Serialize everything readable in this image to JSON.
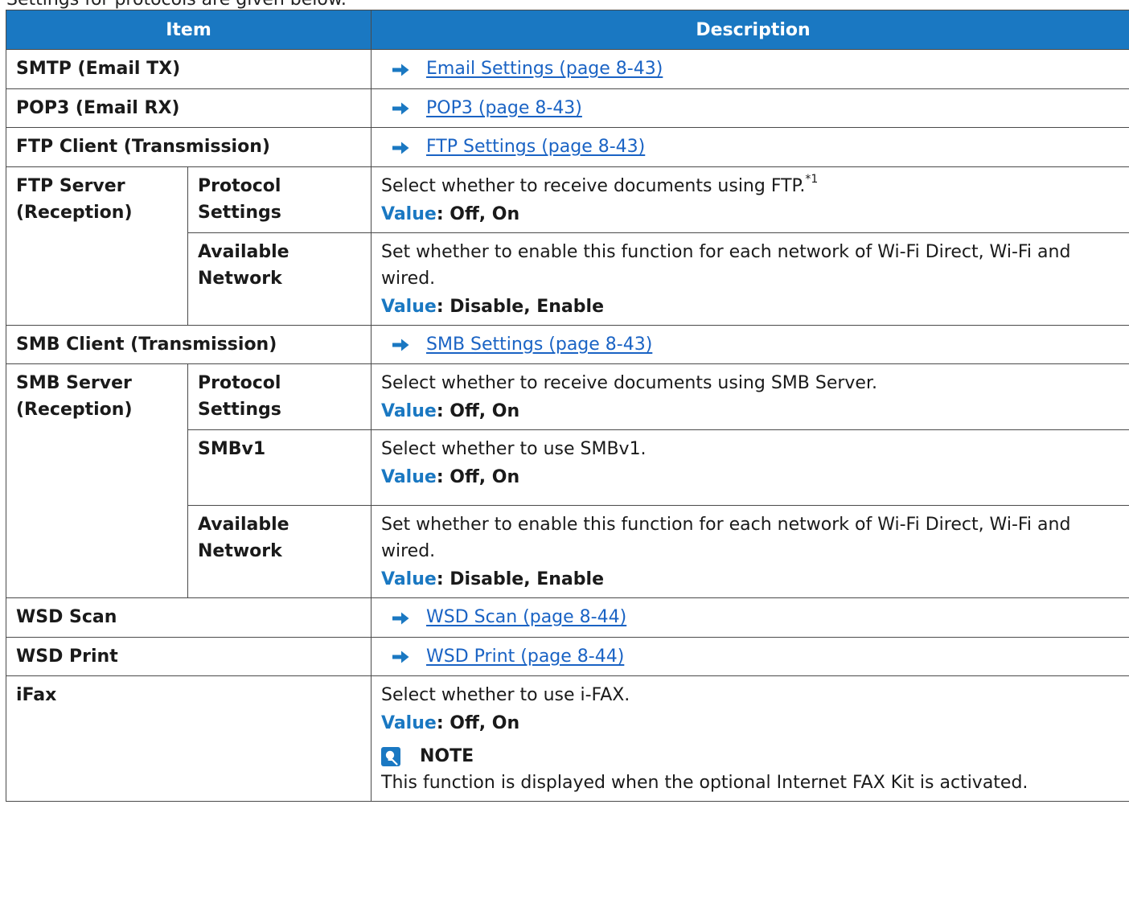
{
  "partial_heading": "Settings for protocols are given below.",
  "table": {
    "headers": {
      "item": "Item",
      "description": "Description"
    },
    "rows": {
      "smtp": {
        "item": "SMTP (Email TX)",
        "link": "Email Settings (page 8-43)"
      },
      "pop3": {
        "item": "POP3 (Email RX)",
        "link": "POP3 (page 8-43)"
      },
      "ftp_client": {
        "item": "FTP Client (Transmission)",
        "link": "FTP Settings (page 8-43)"
      },
      "ftp_server": {
        "item": "FTP Server (Reception)",
        "protocol": {
          "sub": "Protocol Settings",
          "desc": "Select whether to receive documents using FTP.",
          "footnote": "*1",
          "value_label": "Value",
          "value": ": Off, On"
        },
        "network": {
          "sub": "Available Network",
          "desc": "Set whether to enable this function for each network of Wi-Fi Direct, Wi-Fi and wired.",
          "value_label": "Value",
          "value": ": Disable, Enable"
        }
      },
      "smb_client": {
        "item": "SMB Client (Transmission)",
        "link": "SMB Settings (page 8-43)"
      },
      "smb_server": {
        "item": "SMB Server (Reception)",
        "protocol": {
          "sub": "Protocol Settings",
          "desc": "Select whether to receive documents using SMB Server.",
          "value_label": "Value",
          "value": ": Off, On"
        },
        "smbv1": {
          "sub": "SMBv1",
          "desc": "Select whether to use SMBv1.",
          "value_label": "Value",
          "value": ": Off, On"
        },
        "network": {
          "sub": "Available Network",
          "desc": "Set whether to enable this function for each network of Wi-Fi Direct, Wi-Fi and wired.",
          "value_label": "Value",
          "value": ": Disable, Enable"
        }
      },
      "wsd_scan": {
        "item": "WSD Scan",
        "link": "WSD Scan (page 8-44)"
      },
      "wsd_print": {
        "item": "WSD Print",
        "link": "WSD Print (page 8-44)"
      },
      "ifax": {
        "item": "iFax",
        "desc": "Select whether to use i-FAX.",
        "value_label": "Value",
        "value": ": Off, On",
        "note_title": "NOTE",
        "note_text": "This function is displayed when the optional Internet FAX Kit is activated."
      }
    }
  },
  "colors": {
    "header_bg": "#1a78c2",
    "value_label": "#1a78c2",
    "link": "#1a63c4",
    "border": "#4a4a4a"
  },
  "icons": {
    "reference": "arrow-right-icon",
    "note": "note-lightbulb-icon"
  }
}
